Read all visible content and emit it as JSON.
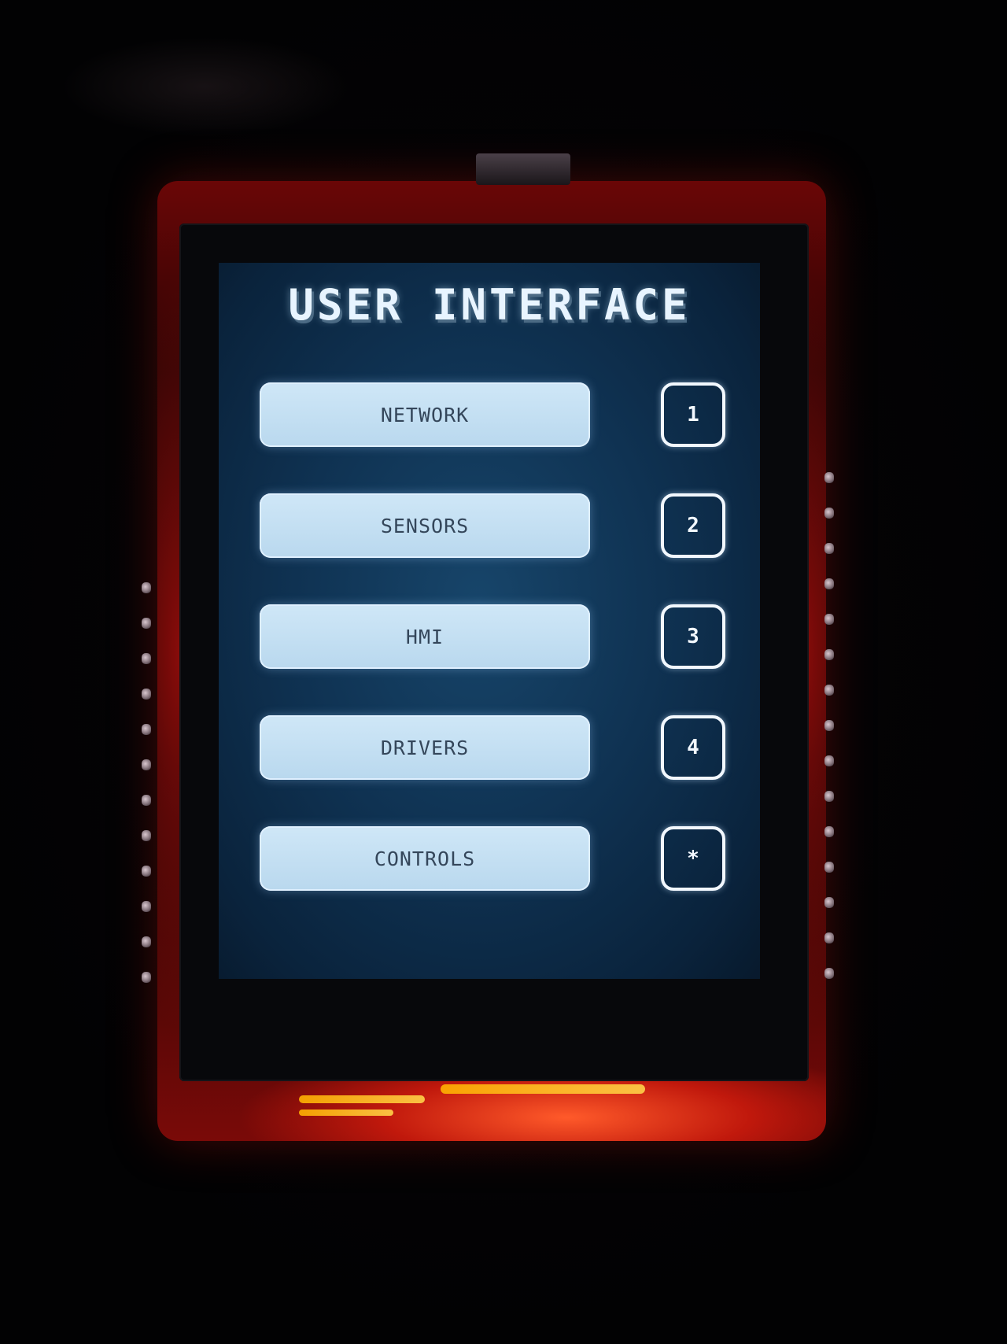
{
  "screen": {
    "title": "USER INTERFACE",
    "menu": [
      {
        "label": "NETWORK",
        "key": "1"
      },
      {
        "label": "SENSORS",
        "key": "2"
      },
      {
        "label": "HMI",
        "key": "3"
      },
      {
        "label": "DRIVERS",
        "key": "4"
      },
      {
        "label": "CONTROLS",
        "key": "*"
      }
    ]
  },
  "colors": {
    "screen_background": "#0f3252",
    "button_fill": "#c4e0f3",
    "button_text": "#34465a",
    "outline": "#f2f8ff",
    "pcb": "#c0180c"
  }
}
